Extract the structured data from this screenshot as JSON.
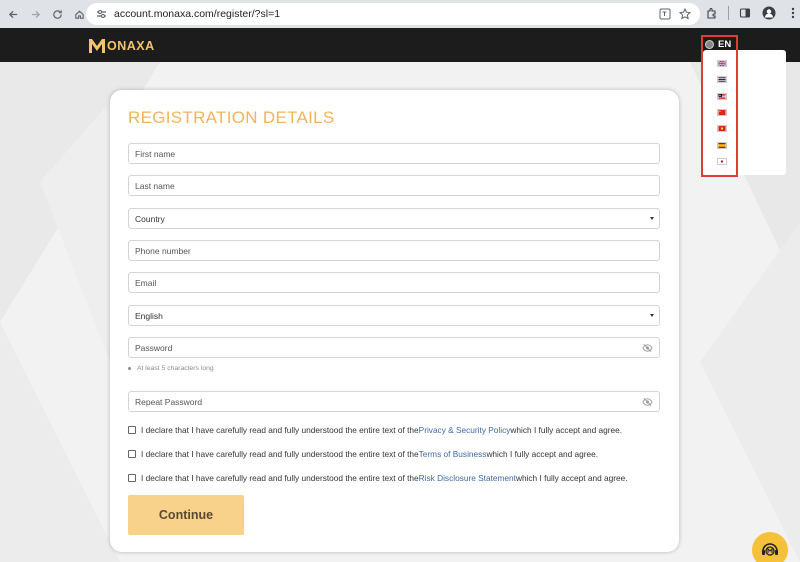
{
  "browser": {
    "url": "account.monaxa.com/register/?sl=1"
  },
  "header": {
    "brand": "ONAXA",
    "language_code": "EN"
  },
  "language_menu": {
    "flags": [
      "uk-flag-icon",
      "thailand-flag-icon",
      "malaysia-flag-icon",
      "china-flag-icon",
      "vietnam-flag-icon",
      "spain-flag-icon",
      "japan-flag-icon"
    ]
  },
  "form": {
    "title": "REGISTRATION DETAILS",
    "first_name_placeholder": "First name",
    "last_name_placeholder": "Last name",
    "country_value": "Country",
    "phone_placeholder": "Phone number",
    "email_placeholder": "Email",
    "language_value": "English",
    "password_placeholder": "Password",
    "password_hint": "At least 5 characters long",
    "repeat_password_placeholder": "Repeat Password",
    "declarations": [
      {
        "prefix": "I declare that I have carefully read and fully understood the entire text of the ",
        "link": "Privacy & Security Policy",
        "suffix": " which I fully accept and agree."
      },
      {
        "prefix": "I declare that I have carefully read and fully understood the entire text of the ",
        "link": "Terms of Business",
        "suffix": " which I fully accept and agree."
      },
      {
        "prefix": "I declare that I have carefully read and fully understood the entire text of the ",
        "link": "Risk Disclosure Statement",
        "suffix": " which I fully accept and agree."
      }
    ],
    "continue_label": "Continue"
  },
  "colors": {
    "accent": "#f2b45b",
    "button": "#f8d28b",
    "link": "#3e6aa4",
    "header_bg": "#1c1c1c",
    "highlight": "#e23b3b"
  }
}
